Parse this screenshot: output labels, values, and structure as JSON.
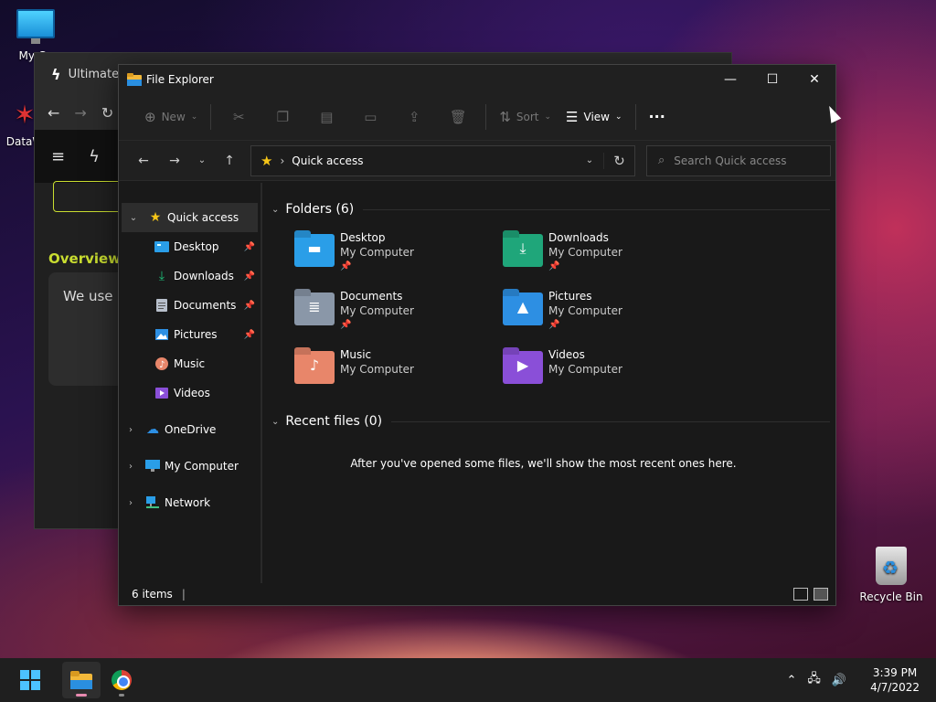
{
  "desktop": {
    "icons": [
      {
        "label": "My Co"
      },
      {
        "label": "DataW"
      },
      {
        "label": "Recycle Bin"
      }
    ]
  },
  "background_window": {
    "tab_title": "Ultimate",
    "overview_label": "Overview",
    "cookie_text": "We use c you signe"
  },
  "explorer": {
    "title": "File Explorer",
    "commands": {
      "new_label": "New",
      "sort_label": "Sort",
      "view_label": "View",
      "more_label": "···"
    },
    "address": {
      "path": "Quick access",
      "search_placeholder": "Search Quick access"
    },
    "nav": {
      "quick_access": "Quick access",
      "items": [
        {
          "label": "Desktop",
          "pinned": true
        },
        {
          "label": "Downloads",
          "pinned": true
        },
        {
          "label": "Documents",
          "pinned": true
        },
        {
          "label": "Pictures",
          "pinned": true
        },
        {
          "label": "Music",
          "pinned": false
        },
        {
          "label": "Videos",
          "pinned": false
        }
      ],
      "onedrive": "OneDrive",
      "my_computer": "My Computer",
      "network": "Network"
    },
    "folders_header": "Folders (6)",
    "folders": [
      {
        "name": "Desktop",
        "location": "My Computer",
        "color": "#2a9ee8",
        "icon": "desktop-glyph"
      },
      {
        "name": "Downloads",
        "location": "My Computer",
        "color": "#1fa67a",
        "icon": "download-arrow"
      },
      {
        "name": "Documents",
        "location": "My Computer",
        "color": "#8a97a8",
        "icon": "document-lines"
      },
      {
        "name": "Pictures",
        "location": "My Computer",
        "color": "#2d8fe3",
        "icon": "mountain"
      },
      {
        "name": "Music",
        "location": "My Computer",
        "color": "#e8866a",
        "icon": "music-note"
      },
      {
        "name": "Videos",
        "location": "My Computer",
        "color": "#8a4fd8",
        "icon": "play-triangle"
      }
    ],
    "recent_header": "Recent files (0)",
    "recent_message": "After you've opened some files, we'll show the most recent ones here.",
    "status": {
      "item_count": "6 items"
    }
  },
  "taskbar": {
    "time": "3:39 PM",
    "date": "4/7/2022"
  }
}
